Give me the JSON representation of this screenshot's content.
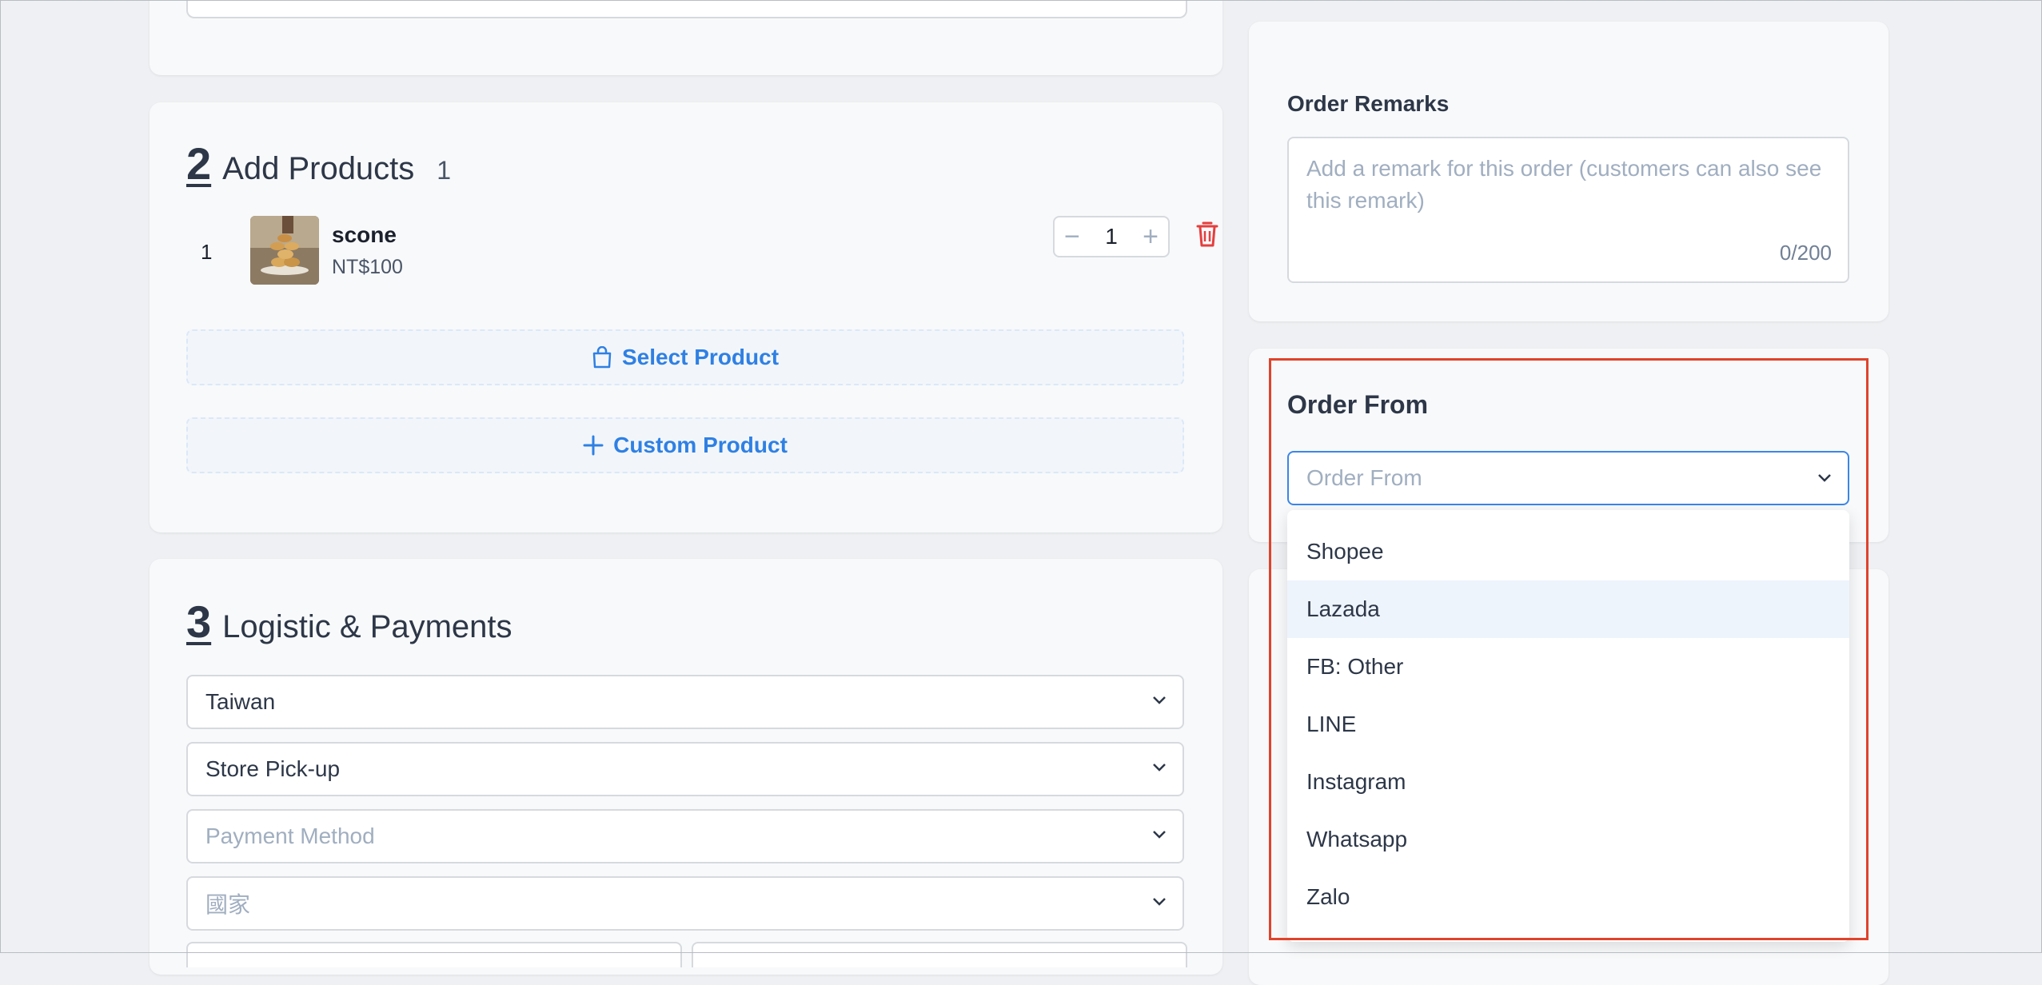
{
  "section2": {
    "number": "2",
    "title": "Add Products",
    "count": "1",
    "product": {
      "index": "1",
      "name": "scone",
      "price": "NT$100",
      "quantity": "1"
    },
    "select_product_label": "Select Product",
    "custom_product_label": "Custom Product"
  },
  "section3": {
    "number": "3",
    "title": "Logistic & Payments",
    "country": "Taiwan",
    "delivery": "Store Pick-up",
    "payment_placeholder": "Payment Method",
    "region_placeholder": "國家"
  },
  "remarks": {
    "label": "Order Remarks",
    "placeholder": "Add a remark for this order (customers can also see this remark)",
    "counter": "0/200"
  },
  "order_from": {
    "label": "Order From",
    "placeholder": "Order From",
    "options": [
      "Shopee",
      "Lazada",
      "FB: Other",
      "LINE",
      "Instagram",
      "Whatsapp",
      "Zalo"
    ],
    "hovered": "Lazada"
  },
  "colors": {
    "accent": "#2f80e3",
    "danger": "#e53e3e",
    "highlight": "#e0432b"
  }
}
